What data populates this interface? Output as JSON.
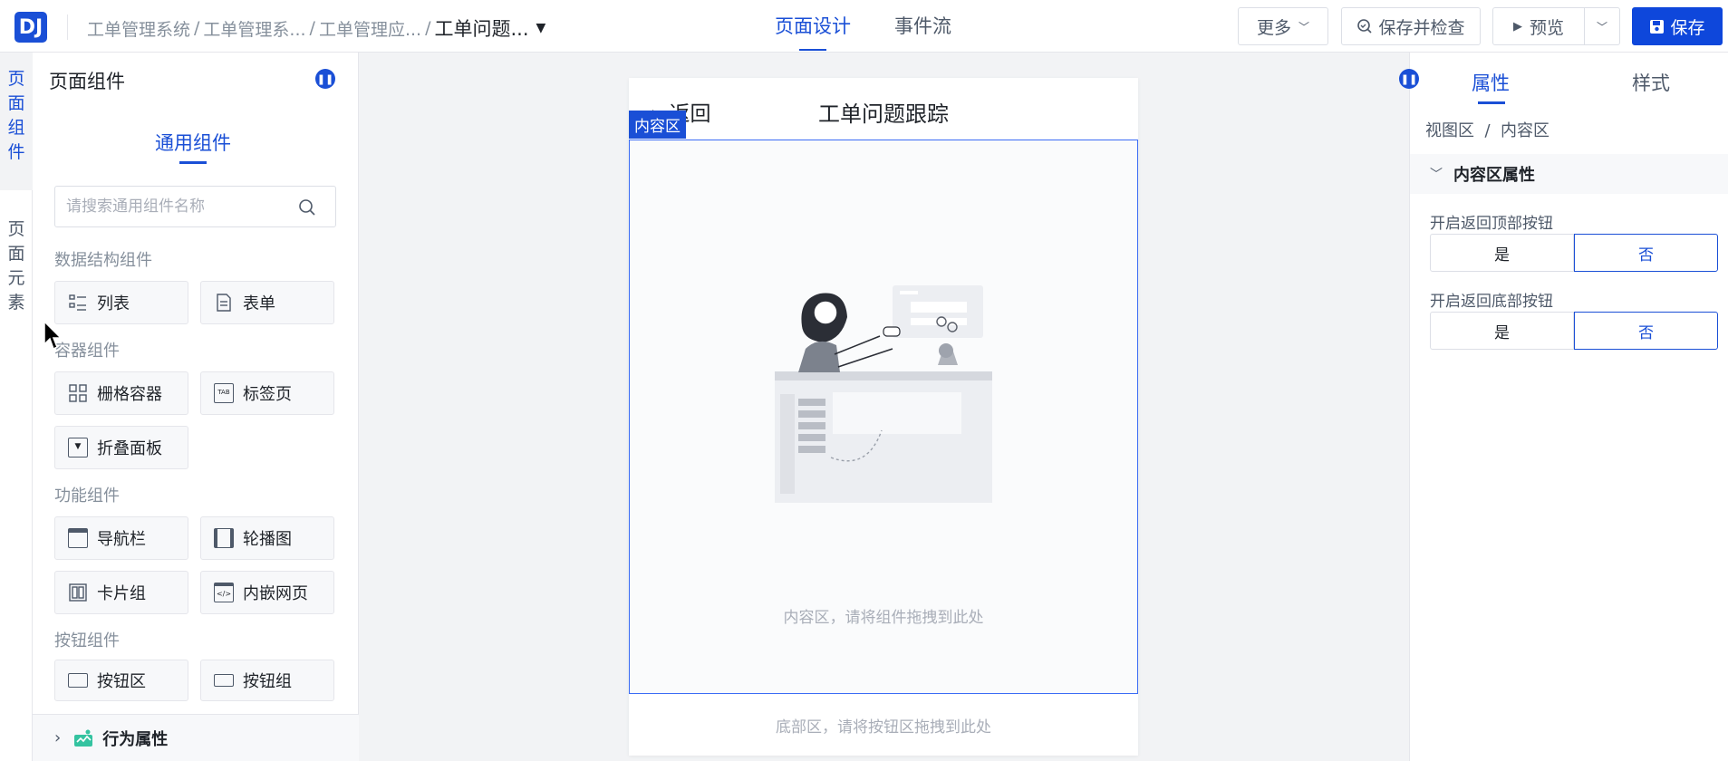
{
  "header": {
    "logo": "DJ",
    "breadcrumbs": [
      "工单管理系统",
      "工单管理系...",
      "工单管理应..."
    ],
    "current_page": "工单问题...",
    "tabs": [
      {
        "label": "页面设计",
        "active": true
      },
      {
        "label": "事件流",
        "active": false
      }
    ],
    "more_label": "更多",
    "save_check_label": "保存并检查",
    "preview_label": "预览",
    "save_label": "保存"
  },
  "left_rail": {
    "items": [
      {
        "label": "页\n面\n组\n件",
        "active": true
      },
      {
        "label": "页\n面\n元\n素",
        "active": false
      }
    ]
  },
  "left_panel": {
    "title": "页面组件",
    "subtab": "通用组件",
    "search_placeholder": "请搜索通用组件名称",
    "groups": [
      {
        "title": "数据结构组件",
        "items": [
          "列表",
          "表单"
        ]
      },
      {
        "title": "容器组件",
        "items": [
          "栅格容器",
          "标签页",
          "折叠面板"
        ]
      },
      {
        "title": "功能组件",
        "items": [
          "导航栏",
          "轮播图",
          "卡片组",
          "内嵌网页"
        ]
      },
      {
        "title": "按钮组件",
        "items": [
          "按钮区",
          "按钮组"
        ]
      }
    ],
    "behavior_label": "行为属性"
  },
  "canvas": {
    "back_label": "返回",
    "page_title": "工单问题跟踪",
    "content_tag": "内容区",
    "content_hint": "内容区，请将组件拖拽到此处",
    "footer_hint": "底部区，请将按钮区拖拽到此处"
  },
  "right_panel": {
    "tabs": [
      {
        "label": "属性",
        "active": true
      },
      {
        "label": "样式",
        "active": false
      }
    ],
    "breadcrumb": "视图区  /  内容区",
    "section_title": "内容区属性",
    "props": [
      {
        "label": "开启返回顶部按钮",
        "options": [
          "是",
          "否"
        ],
        "selected": "否"
      },
      {
        "label": "开启返回底部按钮",
        "options": [
          "是",
          "否"
        ],
        "selected": "否"
      }
    ]
  },
  "colors": {
    "accent": "#1a4fd6",
    "primary_button": "#0e47db"
  }
}
